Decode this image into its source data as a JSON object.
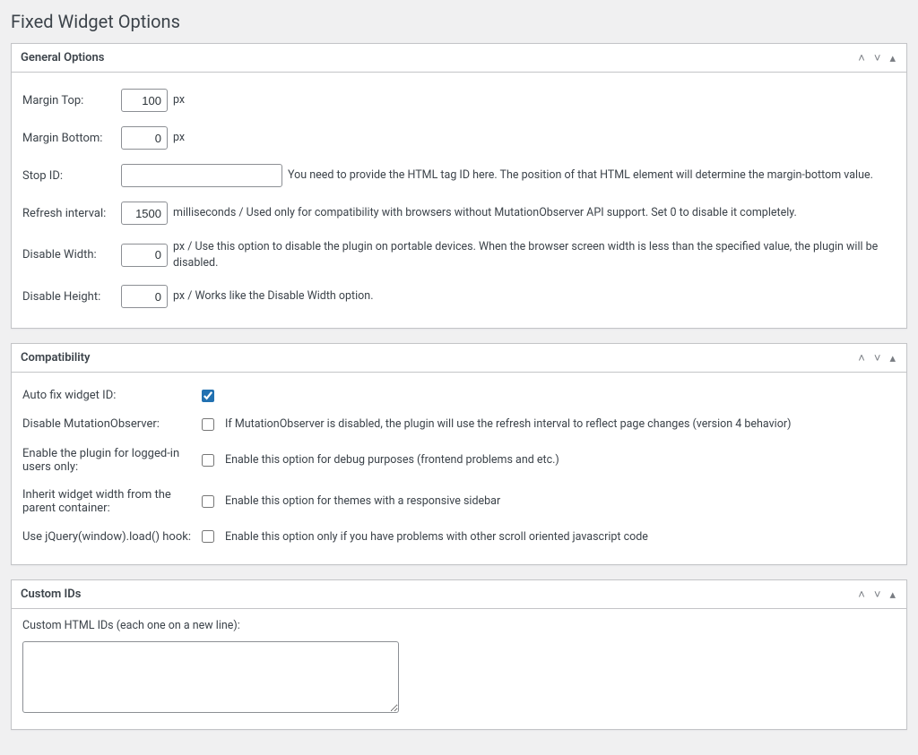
{
  "page": {
    "title": "Fixed Widget Options"
  },
  "panels": {
    "general": {
      "title": "General Options",
      "rows": {
        "margin_top": {
          "label": "Margin Top:",
          "value": "100",
          "suffix": " px"
        },
        "margin_bottom": {
          "label": "Margin Bottom:",
          "value": "0",
          "suffix": " px"
        },
        "stop_id": {
          "label": "Stop ID:",
          "value": "",
          "desc": "You need to provide the HTML tag ID here. The position of that HTML element will determine the margin-bottom value."
        },
        "refresh": {
          "label": "Refresh interval:",
          "value": "1500",
          "desc": "milliseconds / Used only for compatibility with browsers without MutationObserver API support. Set 0 to disable it completely."
        },
        "disable_width": {
          "label": "Disable Width:",
          "value": "0",
          "desc": "px / Use this option to disable the plugin on portable devices. When the browser screen width is less than the specified value, the plugin will be disabled."
        },
        "disable_height": {
          "label": "Disable Height:",
          "value": "0",
          "desc": "px / Works like the Disable Width option."
        }
      }
    },
    "compat": {
      "title": "Compatibility",
      "rows": {
        "auto_fix": {
          "label": "Auto fix widget ID:",
          "checked": true
        },
        "disable_mo": {
          "label": "Disable MutationObserver:",
          "checked": false,
          "desc": "If MutationObserver is disabled, the plugin will use the refresh interval to reflect page changes (version 4 behavior)"
        },
        "logged_in": {
          "label": "Enable the plugin for logged-in users only:",
          "checked": false,
          "desc": "Enable this option for debug purposes (frontend problems and etc.)"
        },
        "inherit_w": {
          "label": "Inherit widget width from the parent container:",
          "checked": false,
          "desc": "Enable this option for themes with a responsive sidebar"
        },
        "jq_hook": {
          "label": "Use jQuery(window).load() hook:",
          "checked": false,
          "desc": "Enable this option only if you have problems with other scroll oriented javascript code"
        }
      }
    },
    "custom_ids": {
      "title": "Custom IDs",
      "label": "Custom HTML IDs (each one on a new line):",
      "value": ""
    }
  }
}
